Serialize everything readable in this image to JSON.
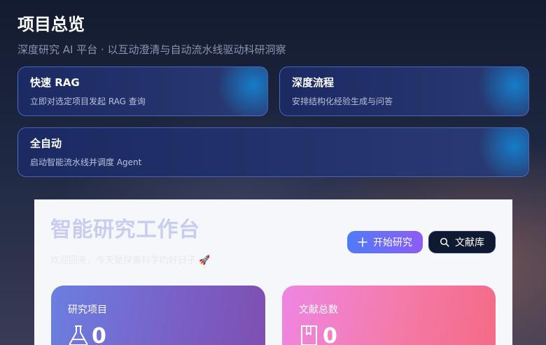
{
  "header": {
    "title": "项目总览",
    "subtitle": "深度研究 AI 平台 · 以互动澄清与自动流水线驱动科研洞察"
  },
  "quick_actions": [
    {
      "title": "快速 RAG",
      "description": "立即对选定项目发起 RAG 查询"
    },
    {
      "title": "深度流程",
      "description": "安排结构化经验生成与问答"
    },
    {
      "title": "全自动",
      "description": "启动智能流水线并调度 Agent"
    }
  ],
  "workspace": {
    "title": "智能研究工作台",
    "subtitle": "欢迎回来，今天是探索科学的好日子 🚀",
    "start_button": "开始研究",
    "library_button": "文献库",
    "stats": [
      {
        "label": "研究项目",
        "value": "0",
        "icon": "flask-icon"
      },
      {
        "label": "文献总数",
        "value": "0",
        "icon": "book-icon"
      }
    ]
  },
  "colors": {
    "accent_start": "#4f7bf6",
    "accent_end": "#8c5cf6",
    "card_border": "#5876d6",
    "projects_card": "#7a5fc6",
    "docs_card": "#f47aa8"
  }
}
